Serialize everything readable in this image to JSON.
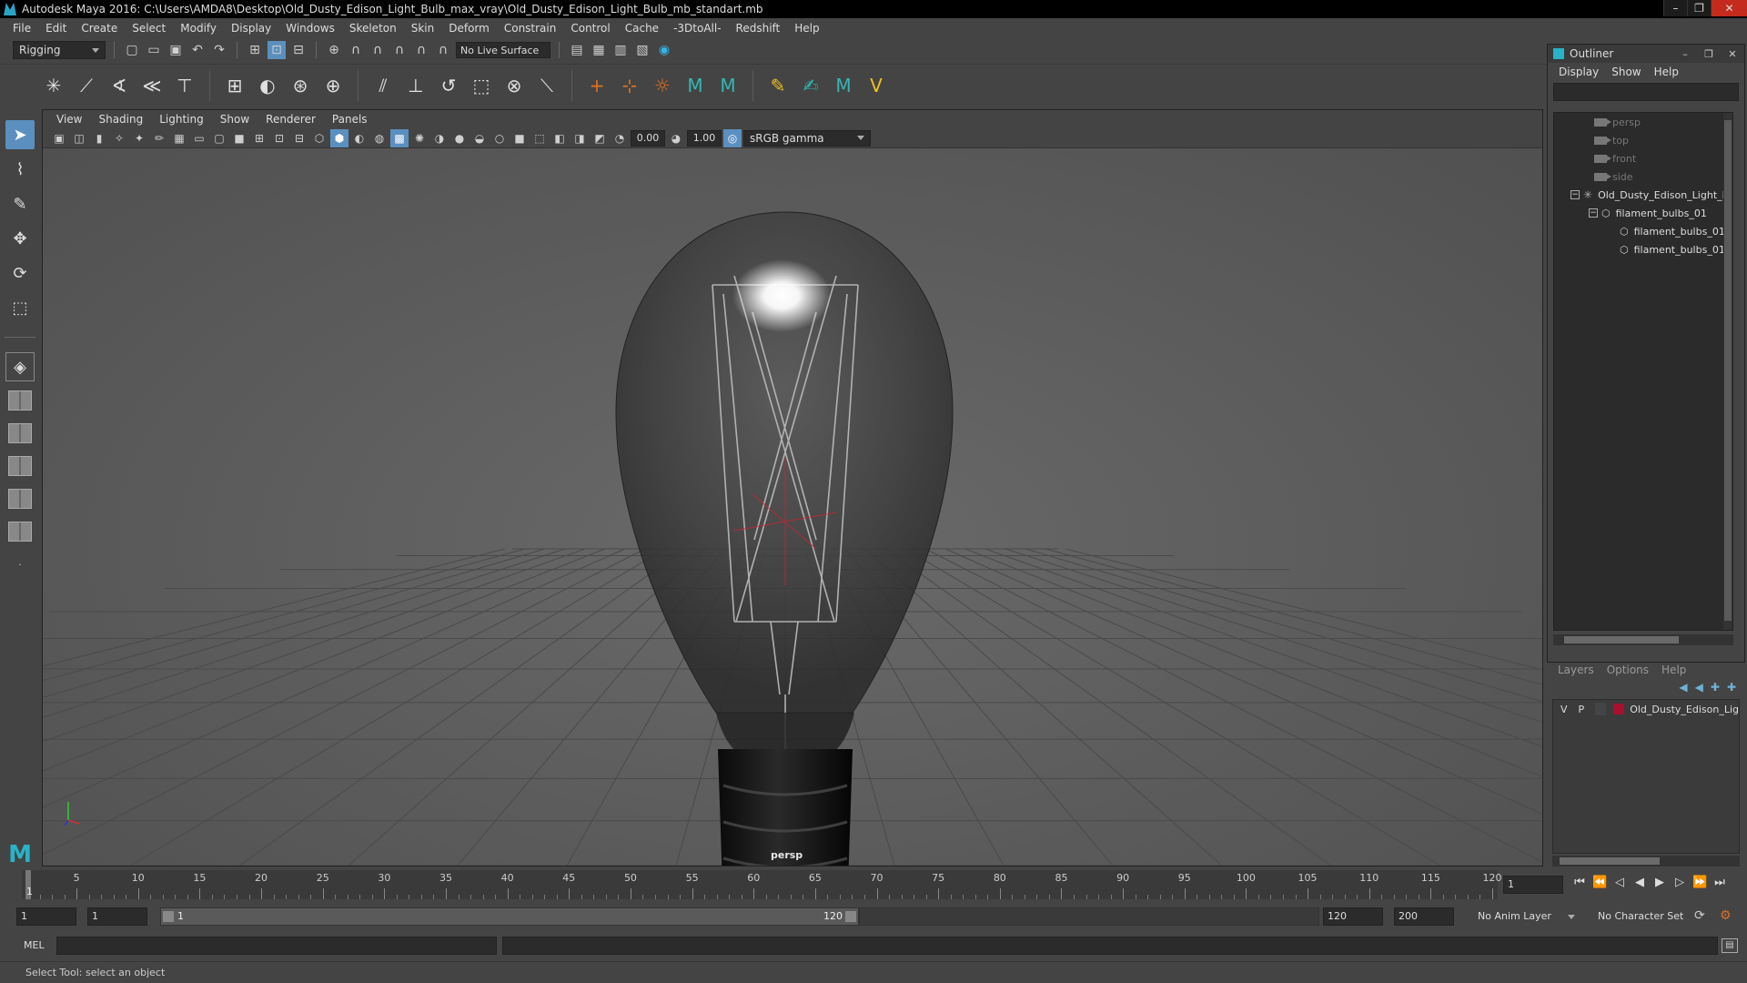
{
  "window": {
    "title": "Autodesk Maya 2016: C:\\Users\\AMDA8\\Desktop\\Old_Dusty_Edison_Light_Bulb_max_vray\\Old_Dusty_Edison_Light_Bulb_mb_standart.mb",
    "controls": [
      "–",
      "❐",
      "✕"
    ]
  },
  "menubar": [
    "File",
    "Edit",
    "Create",
    "Select",
    "Modify",
    "Display",
    "Windows",
    "Skeleton",
    "Skin",
    "Deform",
    "Constrain",
    "Control",
    "Cache",
    "-3DtoAll-",
    "Redshift",
    "Help"
  ],
  "statusline": {
    "menuset": "Rigging",
    "live_surface": "No Live Surface"
  },
  "panel": {
    "menu": [
      "View",
      "Shading",
      "Lighting",
      "Show",
      "Renderer",
      "Panels"
    ],
    "exposure": "0.00",
    "gamma_value": "1.00",
    "color_space": "sRGB gamma",
    "camera": "persp"
  },
  "outliner": {
    "title": "Outliner",
    "menu": [
      "Display",
      "Show",
      "Help"
    ],
    "items": [
      {
        "label": "persp",
        "type": "camera",
        "level": 0
      },
      {
        "label": "top",
        "type": "camera",
        "level": 0
      },
      {
        "label": "front",
        "type": "camera",
        "level": 0
      },
      {
        "label": "side",
        "type": "camera",
        "level": 0
      },
      {
        "label": "Old_Dusty_Edison_Light_B",
        "type": "joint",
        "level": 0
      },
      {
        "label": "filament_bulbs_01",
        "type": "group",
        "level": 1
      },
      {
        "label": "filament_bulbs_01",
        "type": "mesh",
        "level": 2
      },
      {
        "label": "filament_bulbs_01",
        "type": "mesh",
        "level": 2
      }
    ]
  },
  "layers": {
    "menu": [
      "Layers",
      "Options",
      "Help"
    ],
    "rows": [
      {
        "v": "V",
        "p": "P",
        "name": "Old_Dusty_Edison_Lig",
        "color": "#a8102f"
      }
    ]
  },
  "timeslider": {
    "ticks": [
      5,
      10,
      15,
      20,
      25,
      30,
      35,
      40,
      45,
      50,
      55,
      60,
      65,
      70,
      75,
      80,
      85,
      90,
      95,
      100,
      105,
      110,
      115,
      120
    ],
    "current_frame_label": "1",
    "current_frame": "1",
    "min": 1,
    "max": 120
  },
  "rangeslider": {
    "start": "1",
    "playback_start": "1",
    "range_start_label": "1",
    "range_end_label": "120",
    "playback_end": "120",
    "end": "200",
    "anim_layer": "No Anim Layer",
    "character_set": "No Character Set"
  },
  "cmdline": {
    "label": "MEL"
  },
  "helpline": {
    "text": "Select Tool: select an object"
  }
}
